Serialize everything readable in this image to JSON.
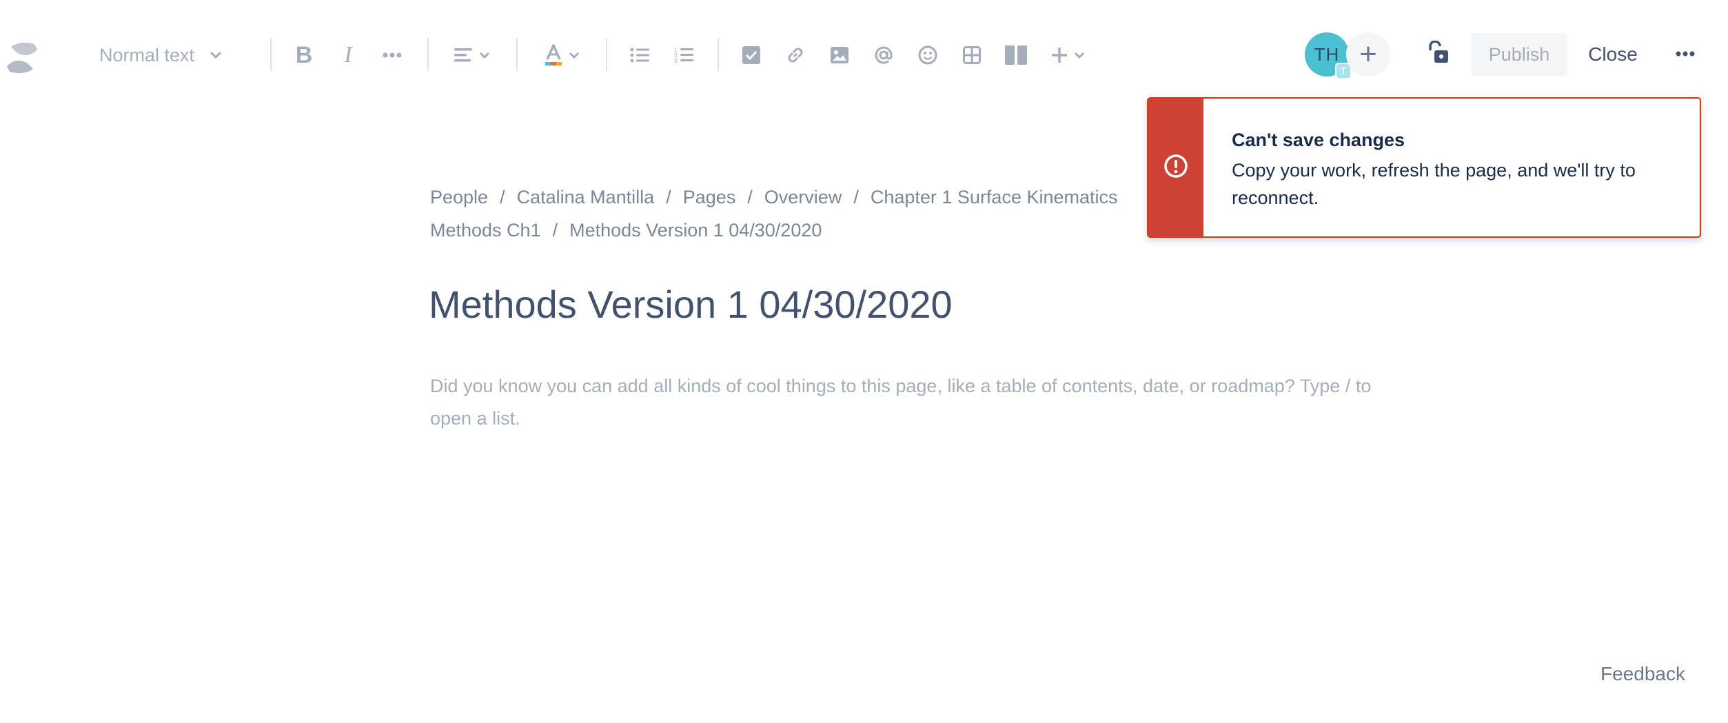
{
  "toolbar": {
    "text_style": "Normal text",
    "bold_label": "B",
    "italic_label": "I",
    "icons": [
      "confluence-logo",
      "chevron-down-icon",
      "more-formatting-icon",
      "align-left-icon",
      "text-color-icon",
      "bullet-list-icon",
      "numbered-list-icon",
      "action-item-icon",
      "link-icon",
      "image-icon",
      "mention-icon",
      "emoji-icon",
      "table-icon",
      "layouts-icon",
      "insert-plus-icon",
      "unlock-icon",
      "more-actions-icon"
    ],
    "collaborator_initials": "TH",
    "collaborator_badge": "T",
    "add_collaborator": "+",
    "publish_label": "Publish",
    "close_label": "Close"
  },
  "flag": {
    "title": "Can't save changes",
    "body": "Copy your work, refresh the page, and we'll try to reconnect.",
    "accent_color": "#cd4234",
    "border_color": "#de350b"
  },
  "breadcrumb": {
    "items": [
      "People",
      "Catalina Mantilla",
      "Pages",
      "Overview",
      "Chapter 1 Surface Kinematics",
      "Methods Ch1",
      "Methods Version 1 04/30/2020"
    ],
    "separator": "/"
  },
  "page": {
    "title": "Methods Version 1 04/30/2020",
    "placeholder": "Did you know you can add all kinds of cool things to this page, like a table of contents, date, or roadmap? Type / to open a list."
  },
  "footer": {
    "feedback_label": "Feedback"
  },
  "colors": {
    "toolbar_icon": "#a5adba",
    "avatar": "#4bc0d2",
    "text_primary": "#172b4d",
    "title": "#42526e"
  }
}
